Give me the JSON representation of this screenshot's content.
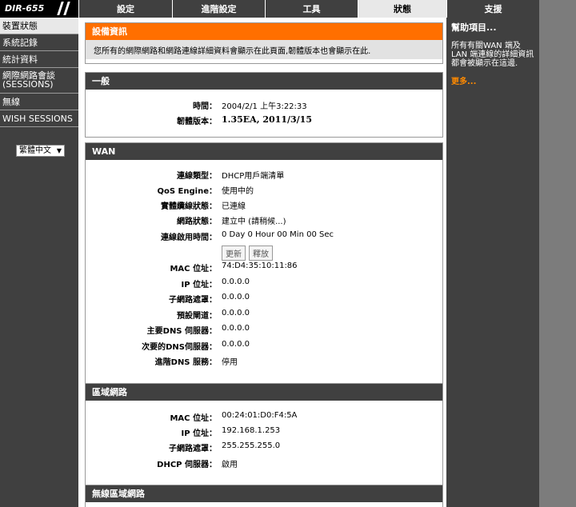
{
  "logo": "DIR-655",
  "tabs": [
    "設定",
    "進階設定",
    "工具",
    "狀態",
    "支援"
  ],
  "sidebar": {
    "items": [
      "裝置狀態",
      "系統記錄",
      "統計資料",
      "網際網路會談\n(SESSIONS)",
      "無線",
      "WISH SESSIONS"
    ],
    "language": "繁體中文"
  },
  "info": {
    "title": "設備資訊",
    "text": "您所有的網際網路和網路連線詳細資料會顯示在此頁面,韌體版本也會顯示在此."
  },
  "general": {
    "title": "一般",
    "rows": [
      {
        "label": "時間：",
        "value": "2004/2/1 上午3:22:33"
      },
      {
        "label": "韌體版本：",
        "value": "1.35EA,  2011/3/15"
      }
    ]
  },
  "wan": {
    "title": "WAN",
    "rows": [
      {
        "label": "連線類型：",
        "value": "DHCP用戶端清單"
      },
      {
        "label": "QoS Engine：",
        "value": "使用中的"
      },
      {
        "label": "實體纜線狀態：",
        "value": "已連線"
      },
      {
        "label": "網路狀態：",
        "value": "建立中 (請稍候...)"
      },
      {
        "label": "連線啟用時間：",
        "value": "0 Day 0 Hour 00 Min 00 Sec"
      },
      {
        "label": "MAC 位址：",
        "value": "74:D4:35:10:11:86"
      },
      {
        "label": "IP 位址：",
        "value": "0.0.0.0"
      },
      {
        "label": "子網路遮罩：",
        "value": "0.0.0.0"
      },
      {
        "label": "預設閘道：",
        "value": "0.0.0.0"
      },
      {
        "label": "主要DNS 伺服器：",
        "value": "0.0.0.0"
      },
      {
        "label": "次要的DNS伺服器：",
        "value": "0.0.0.0"
      },
      {
        "label": "進階DNS 服務：",
        "value": "停用"
      }
    ],
    "renew_label": "更新",
    "release_label": "釋放"
  },
  "lan": {
    "title": "區域網路",
    "rows": [
      {
        "label": "MAC 位址：",
        "value": "00:24:01:D0:F4:5A"
      },
      {
        "label": "IP 位址：",
        "value": "192.168.1.253"
      },
      {
        "label": "子網路遮罩：",
        "value": "255.255.255.0"
      },
      {
        "label": "DHCP 伺服器：",
        "value": "啟用"
      }
    ]
  },
  "wireless": {
    "title": "無線區域網路"
  },
  "help": {
    "title": "幫助項目...",
    "text": "所有有關WAN 端及LAN 端連線的詳細資訊都會被顯示在這邊.",
    "more": "更多..."
  }
}
